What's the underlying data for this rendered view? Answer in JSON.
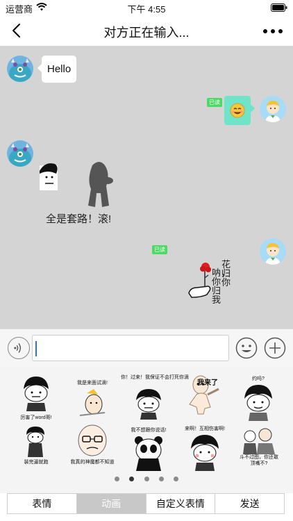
{
  "status_bar": {
    "carrier": "运营商",
    "time": "下午 4:55"
  },
  "nav": {
    "title": "对方正在输入..."
  },
  "messages": {
    "hello_text": "Hello",
    "read_label_1": "已读",
    "sticker_caption": "全是套路！滚!",
    "read_label_2": "已读",
    "flower_text_col1": "呐，你归我",
    "flower_text_col2": "花归你"
  },
  "sticker_panel": {
    "stickers": [
      {
        "label": "厉害了word哥!"
      },
      {
        "label": "我是来面试滴!"
      },
      {
        "label": "你！过来！我保证不会打死你滴"
      },
      {
        "label": "我来了"
      },
      {
        "label": "约吗?"
      },
      {
        "label": "装完逼就跑"
      },
      {
        "label": "我真的神魔都不知道"
      },
      {
        "label": "我不想跟你说话!"
      },
      {
        "label": "来啊！互相伤害啊!"
      },
      {
        "label": "斗不过图，你还敢顶嘴不?"
      }
    ],
    "page_count": 5,
    "active_page": 2
  },
  "tabs": [
    "表情",
    "动画",
    "自定义表情",
    "发送"
  ],
  "selected_tab": "动画"
}
